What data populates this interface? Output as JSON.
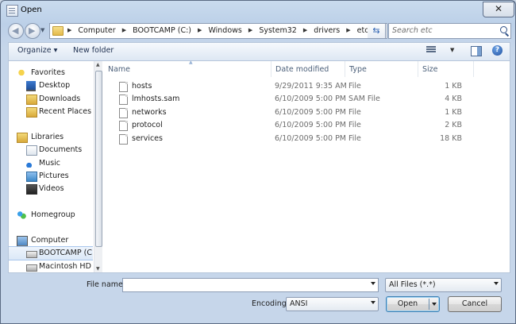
{
  "window": {
    "title": "Open",
    "close_glyph": "✕"
  },
  "address": {
    "crumbs": [
      "Computer",
      "BOOTCAMP (C:)",
      "Windows",
      "System32",
      "drivers",
      "etc"
    ],
    "search_placeholder": "Search etc"
  },
  "toolbar": {
    "organize": "Organize ▾",
    "new_folder": "New folder"
  },
  "nav": {
    "favorites": "Favorites",
    "desktop": "Desktop",
    "downloads": "Downloads",
    "recent_places": "Recent Places",
    "libraries": "Libraries",
    "documents": "Documents",
    "music": "Music",
    "pictures": "Pictures",
    "videos": "Videos",
    "homegroup": "Homegroup",
    "computer": "Computer",
    "bootcamp": "BOOTCAMP (C:)",
    "macintosh": "Macintosh HD (E"
  },
  "columns": {
    "name": "Name",
    "date": "Date modified",
    "type": "Type",
    "size": "Size"
  },
  "files": [
    {
      "name": "hosts",
      "date": "9/29/2011 9:35 AM",
      "type": "File",
      "size": "1 KB"
    },
    {
      "name": "lmhosts.sam",
      "date": "6/10/2009 5:00 PM",
      "type": "SAM File",
      "size": "4 KB"
    },
    {
      "name": "networks",
      "date": "6/10/2009 5:00 PM",
      "type": "File",
      "size": "1 KB"
    },
    {
      "name": "protocol",
      "date": "6/10/2009 5:00 PM",
      "type": "File",
      "size": "2 KB"
    },
    {
      "name": "services",
      "date": "6/10/2009 5:00 PM",
      "type": "File",
      "size": "18 KB"
    }
  ],
  "bottom": {
    "file_name_label": "File name:",
    "file_name_value": "",
    "file_type": "All Files  (*.*)",
    "encoding_label": "Encoding:",
    "encoding_value": "ANSI",
    "open": "Open",
    "cancel": "Cancel"
  }
}
